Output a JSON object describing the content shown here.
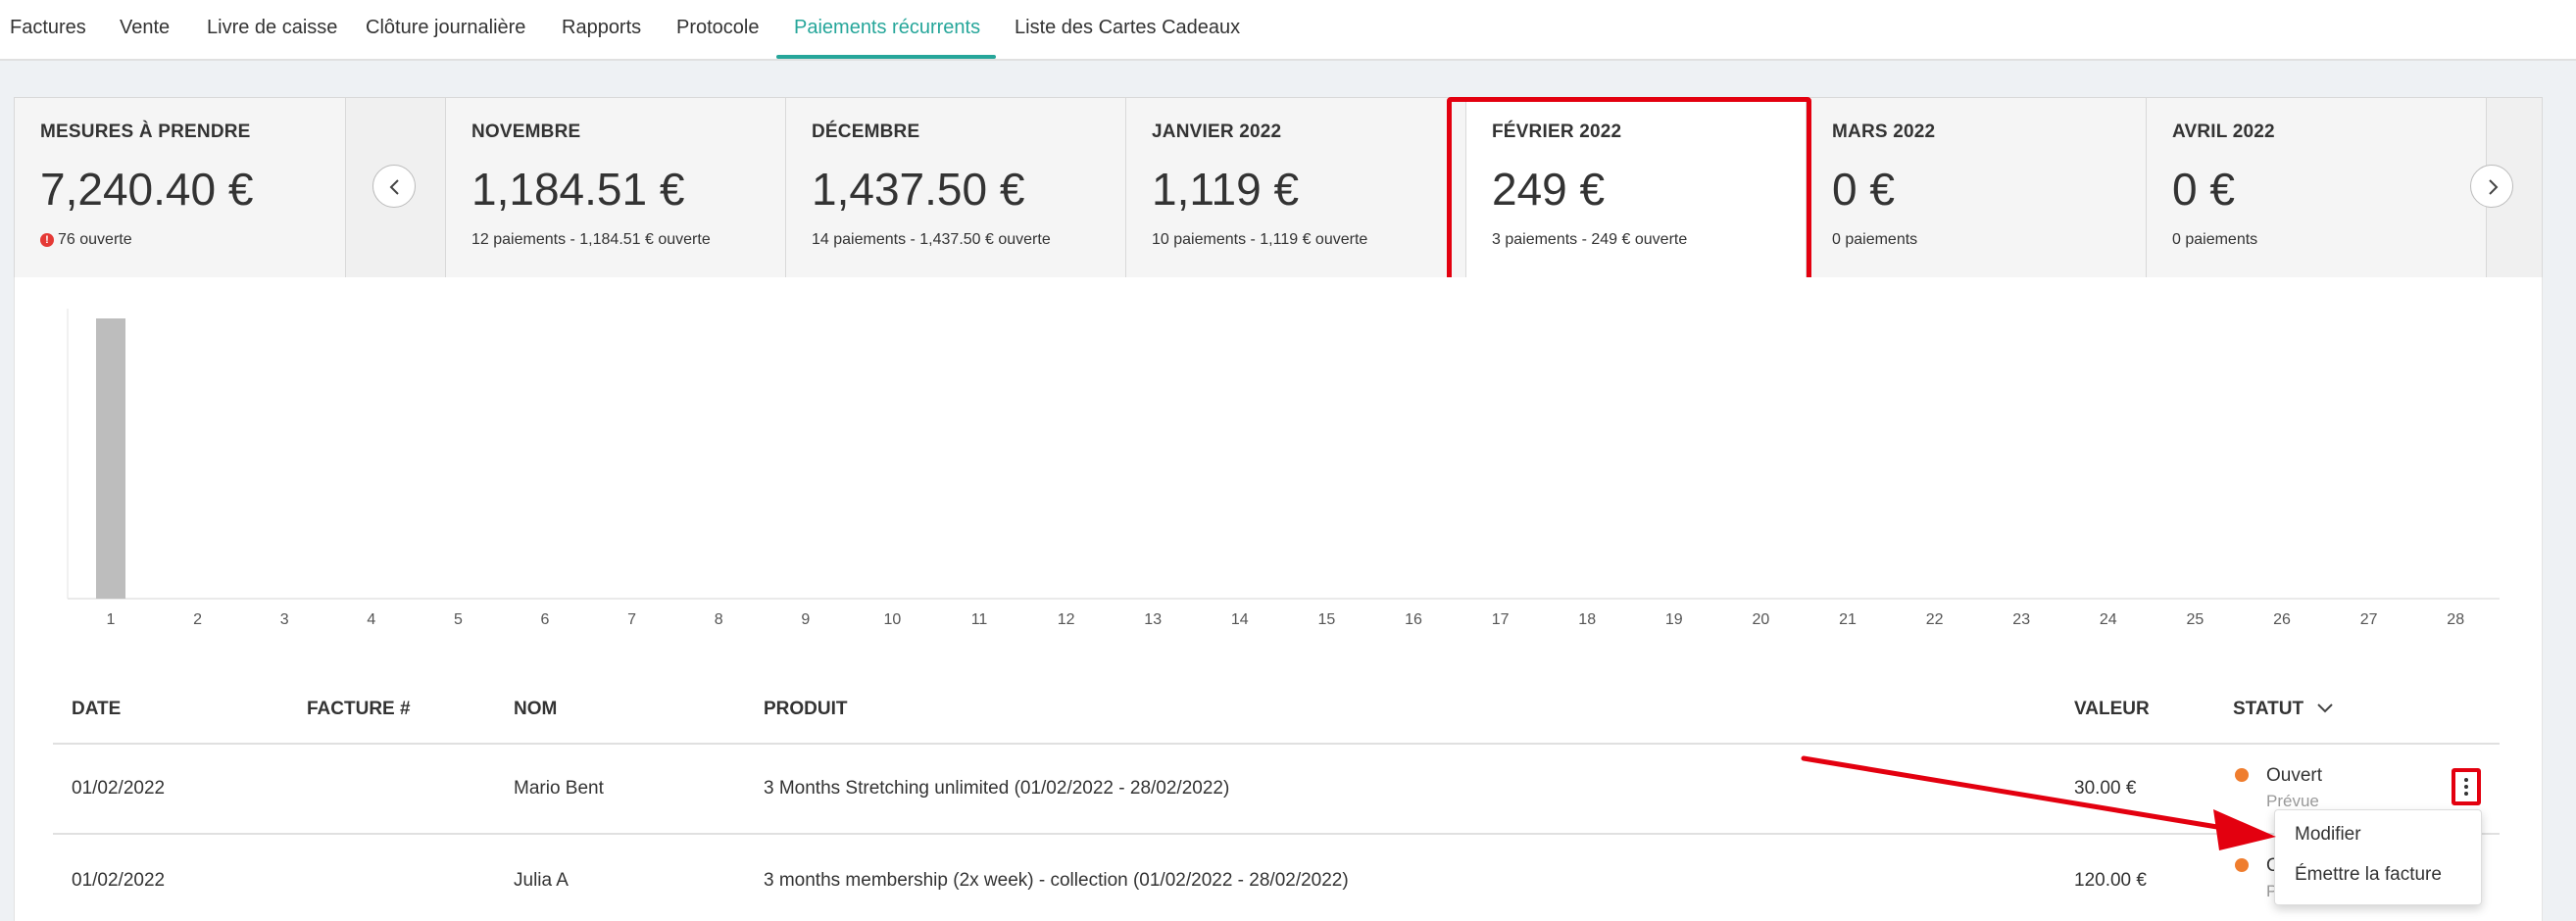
{
  "nav": {
    "tabs": [
      {
        "label": "Factures"
      },
      {
        "label": "Vente"
      },
      {
        "label": "Livre de caisse"
      },
      {
        "label": "Clôture journalière"
      },
      {
        "label": "Rapports"
      },
      {
        "label": "Protocole"
      },
      {
        "label": "Paiements récurrents"
      },
      {
        "label": "Liste des Cartes Cadeaux"
      }
    ],
    "active_tab": "Paiements récurrents"
  },
  "kpis": {
    "actions": {
      "title": "MESURES À PRENDRE",
      "amount": "7,240.40 €",
      "open_count": "76 ouverte"
    },
    "months": [
      {
        "title": "NOVEMBRE",
        "amount": "1,184.51 €",
        "sub": "12 paiements - 1,184.51 € ouverte"
      },
      {
        "title": "DÉCEMBRE",
        "amount": "1,437.50 €",
        "sub": "14 paiements - 1,437.50 € ouverte"
      },
      {
        "title": "JANVIER 2022",
        "amount": "1,119 €",
        "sub": "10 paiements - 1,119 € ouverte"
      },
      {
        "title": "FÉVRIER 2022",
        "amount": "249 €",
        "sub": "3 paiements - 249 € ouverte"
      },
      {
        "title": "MARS 2022",
        "amount": "0 €",
        "sub": "0 paiements"
      },
      {
        "title": "AVRIL 2022",
        "amount": "0 €",
        "sub": "0 paiements"
      }
    ],
    "selected_month": "FÉVRIER 2022",
    "alert_color": "#e53935"
  },
  "chart_data": {
    "type": "bar",
    "categories": [
      "1",
      "2",
      "3",
      "4",
      "5",
      "6",
      "7",
      "8",
      "9",
      "10",
      "11",
      "12",
      "13",
      "14",
      "15",
      "16",
      "17",
      "18",
      "19",
      "20",
      "21",
      "22",
      "23",
      "24",
      "25",
      "26",
      "27",
      "28"
    ],
    "values": [
      249,
      0,
      0,
      0,
      0,
      0,
      0,
      0,
      0,
      0,
      0,
      0,
      0,
      0,
      0,
      0,
      0,
      0,
      0,
      0,
      0,
      0,
      0,
      0,
      0,
      0,
      0,
      0
    ],
    "ylim": [
      0,
      249
    ],
    "grid": false,
    "bar_color": "#bdbdbd"
  },
  "table": {
    "columns": [
      "DATE",
      "FACTURE #",
      "NOM",
      "PRODUIT",
      "VALEUR",
      "STATUT"
    ],
    "rows": [
      {
        "date": "01/02/2022",
        "invoice": "",
        "name": "Mario Bent",
        "product": "3 Months Stretching unlimited (01/02/2022 - 28/02/2022)",
        "value": "30.00 €",
        "status": "Ouvert",
        "status_sub": "Prévue"
      },
      {
        "date": "01/02/2022",
        "invoice": "",
        "name": "Julia A",
        "product": "3 months membership (2x week) - collection (01/02/2022 - 28/02/2022)",
        "value": "120.00 €",
        "status": "O",
        "status_sub": "P"
      }
    ],
    "status_color": "#ef7d2e"
  },
  "row_menu": {
    "items": [
      {
        "label": "Modifier"
      },
      {
        "label": "Émettre la facture"
      }
    ]
  },
  "colors": {
    "accent": "#26a69a",
    "annotation": "#e3000f"
  }
}
